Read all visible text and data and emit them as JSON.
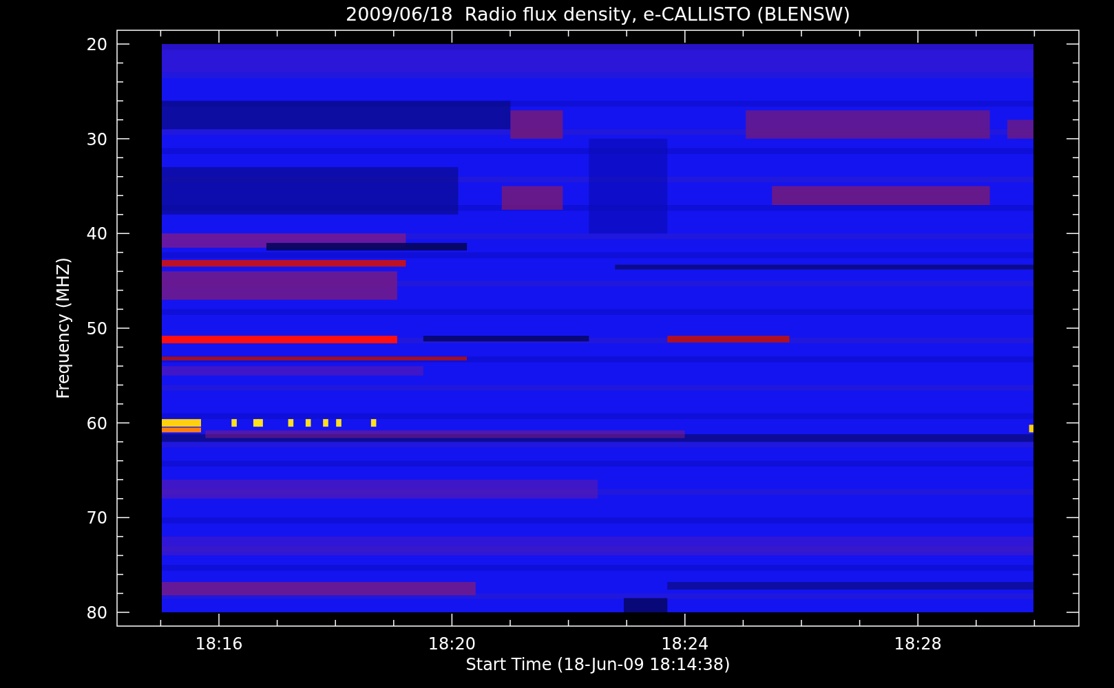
{
  "title": "2009/06/18  Radio flux density, e-CALLISTO (BLENSW)",
  "y_axis": {
    "label": "Frequency (MHZ)",
    "ticks": [
      "20",
      "30",
      "40",
      "50",
      "60",
      "70",
      "80"
    ]
  },
  "x_axis": {
    "label": "Start Time (18-Jun-09 18:14:38)",
    "ticks": [
      "18:16",
      "18:20",
      "18:24",
      "18:28"
    ]
  }
}
